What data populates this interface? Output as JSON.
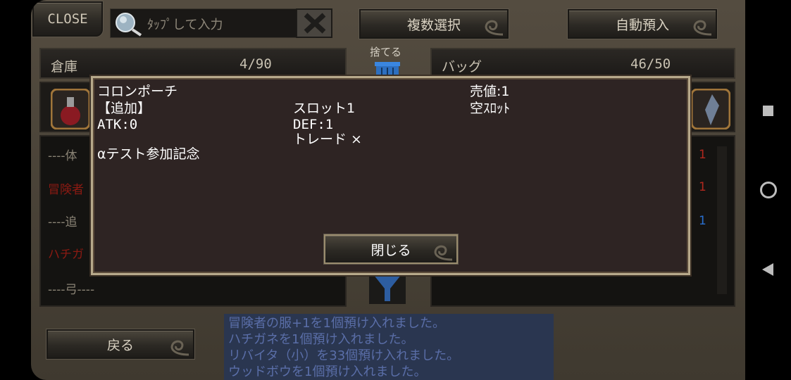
{
  "top_bar": {
    "close_label": "CLOSE",
    "search_placeholder": "ﾀｯﾌﾟして入力",
    "multi_select_label": "複数選択",
    "auto_deposit_label": "自動預入"
  },
  "discard_label": "捨てる",
  "storage": {
    "title": "倉庫",
    "count": "4/90",
    "rows": [
      "----体",
      "冒険者",
      "----追",
      "ハチガ",
      "----弓----"
    ]
  },
  "bag": {
    "title": "バッグ",
    "count": "46/50",
    "qtys": [
      "1",
      "1",
      "1"
    ]
  },
  "item_popup": {
    "name": "コロンポーチ",
    "tag": "【追加】",
    "atk": "ATK:0",
    "note": "αテスト参加記念",
    "slot": "スロット1",
    "def": "DEF:1",
    "trade": "トレード ×",
    "sell": "売値:1",
    "empty_slot": "空ｽﾛｯﾄ",
    "close_label": "閉じる"
  },
  "back_label": "戻る",
  "log_lines": [
    "冒険者の服+1を1個預け入れました。",
    "ハチガネを1個預け入れました。",
    "リバイタ（小）を33個預け入れました。",
    "ウッドボウを1個預け入れました。"
  ],
  "colors": {
    "red_text": "#8b1a12",
    "blue_qty": "#2a6fd0",
    "red_qty": "#b0281e"
  }
}
